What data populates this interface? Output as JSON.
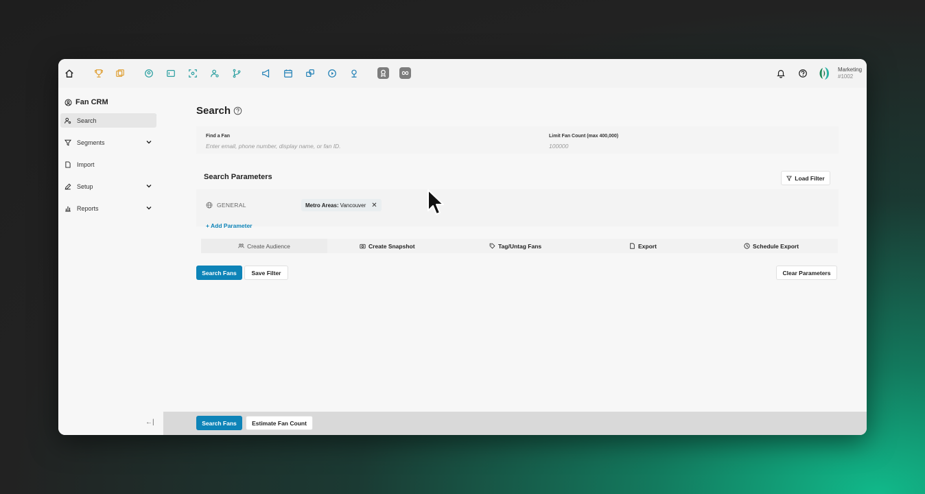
{
  "org": {
    "name": "Marketing",
    "id": "#1002"
  },
  "sidebar": {
    "title": "Fan CRM",
    "items": [
      {
        "label": "Search",
        "active": true,
        "expandable": false,
        "icon": "users-search-icon"
      },
      {
        "label": "Segments",
        "active": false,
        "expandable": true,
        "icon": "filter-icon"
      },
      {
        "label": "Import",
        "active": false,
        "expandable": false,
        "icon": "file-icon"
      },
      {
        "label": "Setup",
        "active": false,
        "expandable": true,
        "icon": "edit-icon"
      },
      {
        "label": "Reports",
        "active": false,
        "expandable": true,
        "icon": "chart-icon"
      }
    ],
    "collapse_label": "←|"
  },
  "page": {
    "title": "Search"
  },
  "find": {
    "label": "Find a Fan",
    "placeholder": "Enter email, phone number, display name, or fan ID.",
    "limit_label": "Limit Fan Count (max 400,000)",
    "limit_placeholder": "100000"
  },
  "params": {
    "title": "Search Parameters",
    "load_filter": "Load Filter",
    "category": "GENERAL",
    "chip_key": "Metro Areas:",
    "chip_value": "Vancouver",
    "chip_remove": "✕",
    "add_parameter": "+ Add Parameter"
  },
  "actions": [
    {
      "label": "Create Audience",
      "icon": "audience-icon"
    },
    {
      "label": "Create Snapshot",
      "icon": "camera-icon"
    },
    {
      "label": "Tag/Untag Fans",
      "icon": "tag-icon"
    },
    {
      "label": "Export",
      "icon": "file-export-icon"
    },
    {
      "label": "Schedule Export",
      "icon": "clock-icon"
    }
  ],
  "buttons": {
    "search_fans": "Search Fans",
    "save_filter": "Save Filter",
    "clear_parameters": "Clear Parameters",
    "estimate_fan_count": "Estimate Fan Count"
  },
  "colors": {
    "accent": "#0e84b8",
    "teal": "#2bb3a3",
    "gold": "#e0a23a"
  }
}
